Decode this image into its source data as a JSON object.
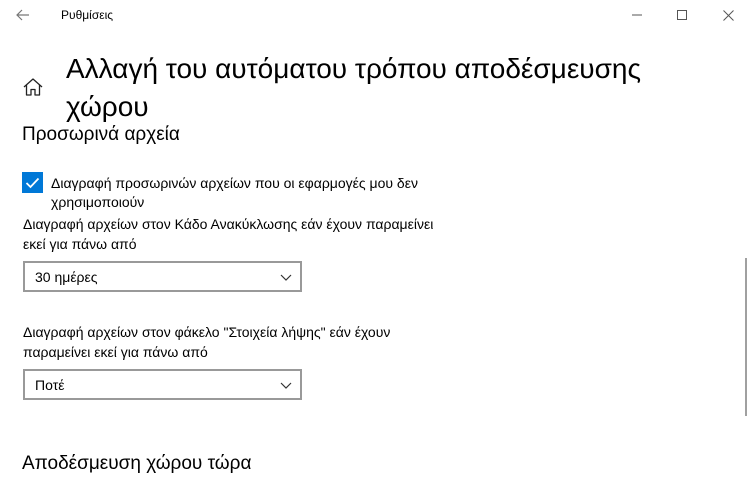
{
  "window": {
    "app_title": "Ρυθμίσεις"
  },
  "page": {
    "title": "Αλλαγή του αυτόματου τρόπου αποδέσμευσης χώρου"
  },
  "temp_files": {
    "section_title": "Προσωρινά αρχεία",
    "checkbox_label": "Διαγραφή προσωρινών αρχείων που οι εφαρμογές μου δεν χρησιμοποιούν",
    "checkbox_checked": true,
    "recycle_bin_label": "Διαγραφή αρχείων στον Κάδο Ανακύκλωσης εάν έχουν παραμείνει εκεί για πάνω από",
    "recycle_bin_value": "30 ημέρες",
    "downloads_label": "Διαγραφή αρχείων στον φάκελο \"Στοιχεία λήψης\" εάν έχουν παραμείνει εκεί για πάνω από",
    "downloads_value": "Ποτέ"
  },
  "free_space": {
    "section_title": "Αποδέσμευση χώρου τώρα"
  },
  "colors": {
    "accent": "#0078d7",
    "dropdown_border": "#999999"
  },
  "icons": {
    "back": "back-arrow-icon",
    "home": "home-icon",
    "minimize": "minimize-icon",
    "maximize": "maximize-icon",
    "close": "close-icon",
    "checkmark": "checkmark-icon",
    "chevron": "chevron-down-icon"
  }
}
